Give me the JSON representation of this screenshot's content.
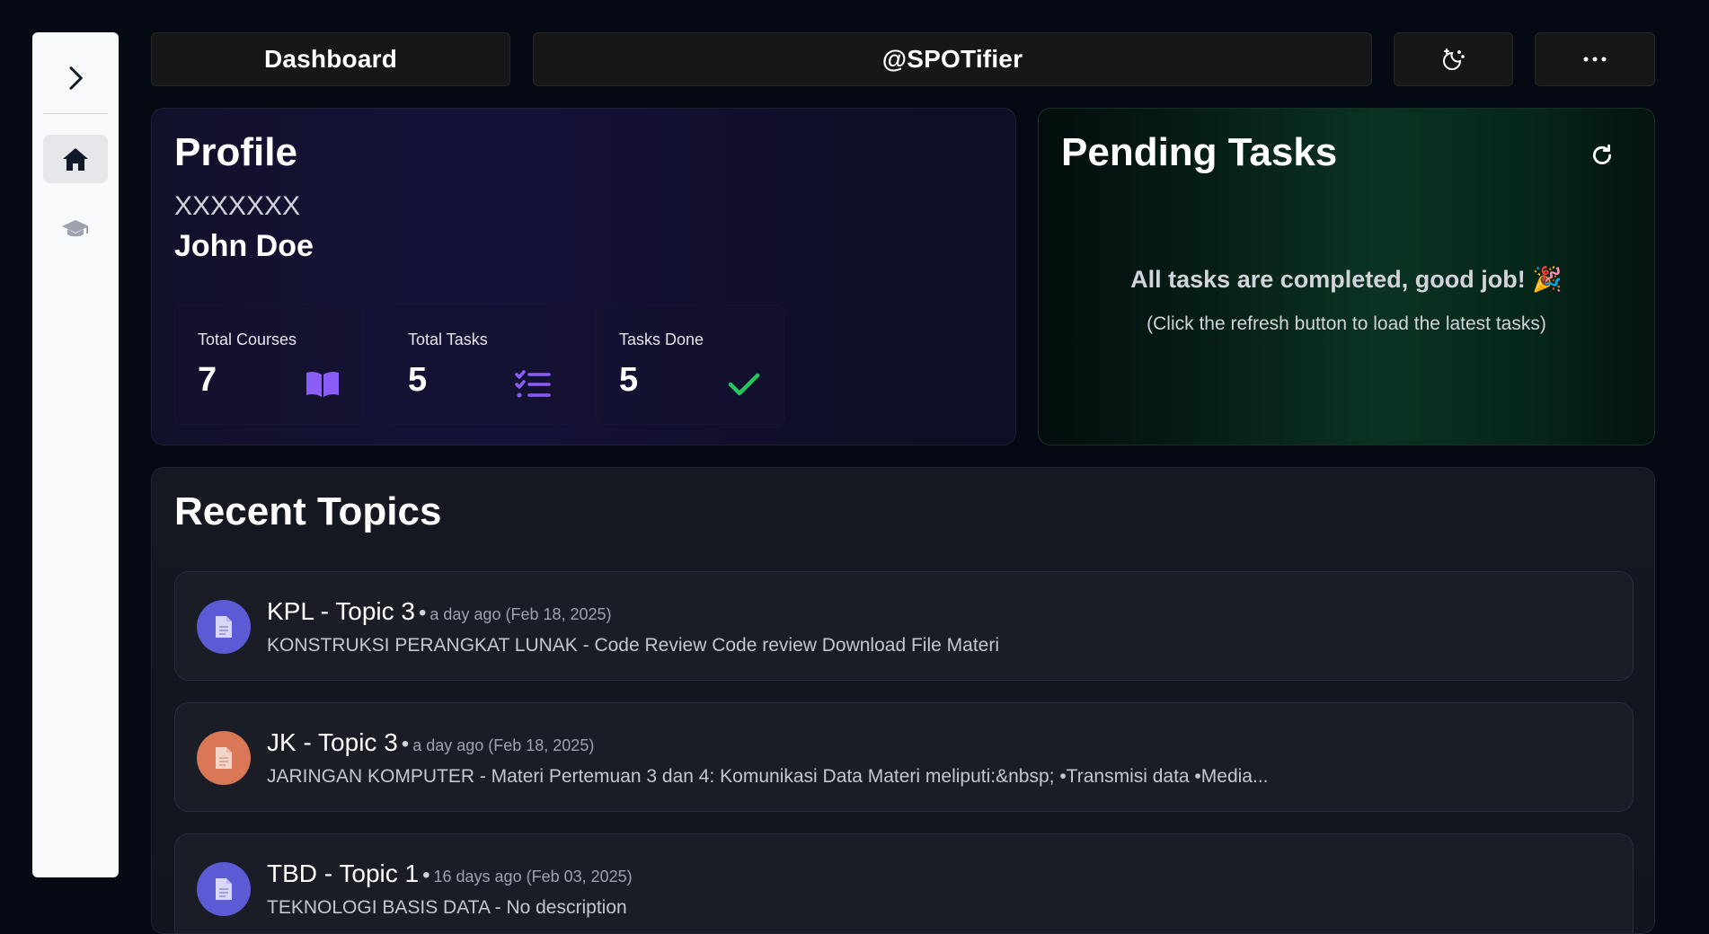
{
  "topbar": {
    "dashboard_label": "Dashboard",
    "username_label": "@SPOTifier",
    "theme_icon": "moon-stars-icon",
    "more_icon": "ellipsis-icon"
  },
  "sidebar": {
    "toggle_icon": "chevron-right-icon",
    "items": [
      {
        "name": "home",
        "icon": "home-icon",
        "active": true
      },
      {
        "name": "courses",
        "icon": "graduation-cap-icon",
        "active": false
      }
    ]
  },
  "profile": {
    "title": "Profile",
    "username": "XXXXXXX",
    "name": "John Doe",
    "stats": [
      {
        "label": "Total Courses",
        "value": "7",
        "icon": "book-icon"
      },
      {
        "label": "Total Tasks",
        "value": "5",
        "icon": "list-check-icon"
      },
      {
        "label": "Tasks Done",
        "value": "5",
        "icon": "check-icon"
      }
    ]
  },
  "pending": {
    "title": "Pending Tasks",
    "message": "All tasks are completed, good job! 🎉",
    "sub": "(Click the refresh button to load the latest tasks)",
    "refresh_icon": "refresh-icon"
  },
  "topics": {
    "title": "Recent Topics",
    "items": [
      {
        "title": "KPL - Topic 3",
        "time": "a day ago (Feb 18, 2025)",
        "desc": "KONSTRUKSI PERANGKAT LUNAK - Code Review Code review Download File Materi",
        "color": "#5b5bd6"
      },
      {
        "title": "JK - Topic 3",
        "time": "a day ago (Feb 18, 2025)",
        "desc": "JARINGAN KOMPUTER - Materi Pertemuan 3 dan 4: Komunikasi Data Materi meliputi:&nbsp; •Transmisi data •Media...",
        "color": "#d97757"
      },
      {
        "title": "TBD - Topic 1",
        "time": "16 days ago (Feb 03, 2025)",
        "desc": "TEKNOLOGI BASIS DATA - No description",
        "color": "#5b5bd6"
      }
    ]
  },
  "colors": {
    "accent_purple": "#8b5cf6",
    "success_green": "#22c55e"
  }
}
